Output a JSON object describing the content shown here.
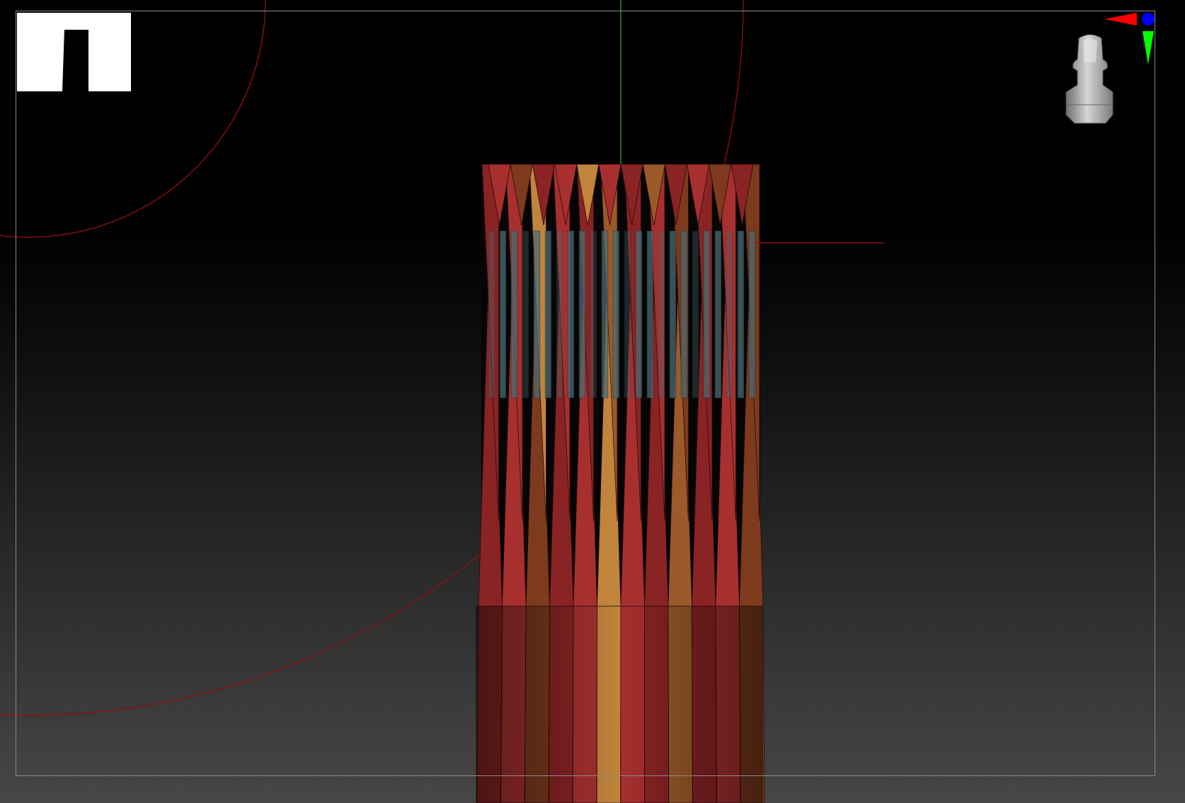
{
  "viewport": {
    "background_top": "#000000",
    "background_bottom": "#474747",
    "frame_color": "#8a8a8a"
  },
  "brush_preview": {
    "icon": "alpha-brush-preview-icon",
    "color": "#ffffff"
  },
  "axis_gizmo": {
    "icon": "axis-gizmo-icon",
    "x_color": "#ff0000",
    "y_color": "#00ff00",
    "z_color": "#0000ff"
  },
  "navigation_head": {
    "icon": "camera-navigation-head-icon",
    "color": "#b0b0b0"
  },
  "model": {
    "icon": "polygroup-cylinder-mesh",
    "colors": [
      "#8a2324",
      "#a7302f",
      "#c0843d",
      "#7d3a1c",
      "#9c5a2a",
      "#4b6b72"
    ]
  },
  "guides": {
    "symmetry_line_color": "#1f8a1f",
    "brush_ring_color": "#8b1010"
  }
}
